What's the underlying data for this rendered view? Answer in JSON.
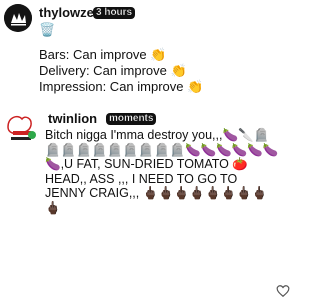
{
  "comments": [
    {
      "username": "thylowzeen",
      "time": "3 hours",
      "trash_emoji": "🗑️",
      "lines": [
        "Bars: Can improve 👏",
        "Delivery: Can improve 👏",
        "Impression: Can improve 👏"
      ]
    },
    {
      "username": "twinlion",
      "time": "moments",
      "text": "Bitch nigga I'mma destroy you,,,🍆🔪🪦🪦🪦🪦🪦🪦🪦🪦🪦🪦🍆🍆🍆🍆🍆🍆🍆,U FAT, SUN-DRIED TOMATO 🍅 HEAD,, ASS ,,, I NEED TO GO TO JENNY CRAIG,,, 🖕🏿🖕🏿🖕🏿🖕🏿🖕🏿🖕🏿🖕🏿🖕🏿🖕🏿"
    }
  ],
  "icons": {
    "like": "heart-outline-icon",
    "delete": "trash-emoji"
  }
}
